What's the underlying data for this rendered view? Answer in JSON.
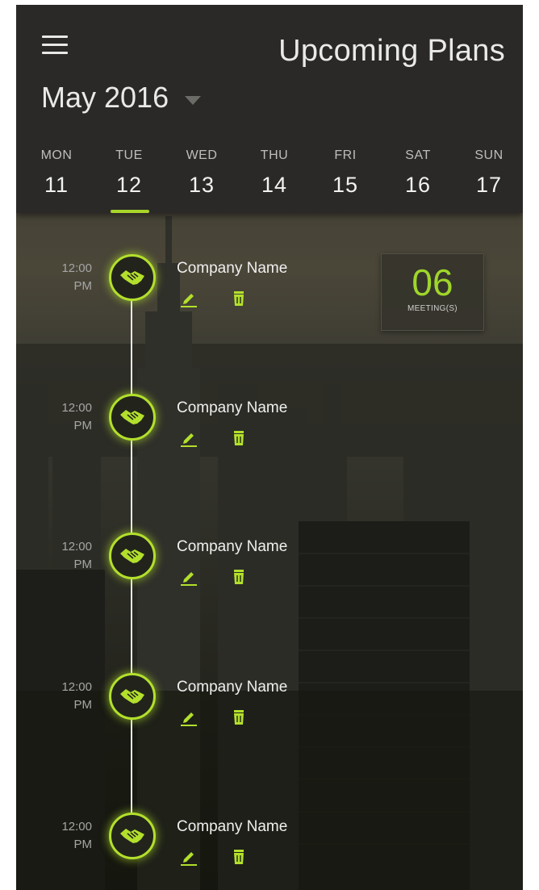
{
  "header": {
    "title": "Upcoming Plans",
    "month": "May 2016"
  },
  "week": [
    {
      "name": "MON",
      "num": "11",
      "active": false
    },
    {
      "name": "TUE",
      "num": "12",
      "active": true
    },
    {
      "name": "WED",
      "num": "13",
      "active": false
    },
    {
      "name": "THU",
      "num": "14",
      "active": false
    },
    {
      "name": "FRI",
      "num": "15",
      "active": false
    },
    {
      "name": "SAT",
      "num": "16",
      "active": false
    },
    {
      "name": "SUN",
      "num": "17",
      "active": false
    }
  ],
  "meetings": {
    "count": "06",
    "label": "MEETING(S)"
  },
  "entries": [
    {
      "time_top": "12:00",
      "time_bottom": "PM",
      "company": "Company Name",
      "icon": "handshake-icon"
    },
    {
      "time_top": "12:00",
      "time_bottom": "PM",
      "company": "Company Name",
      "icon": "handshake-icon"
    },
    {
      "time_top": "12:00",
      "time_bottom": "PM",
      "company": "Company Name",
      "icon": "handshake-icon"
    },
    {
      "time_top": "12:00",
      "time_bottom": "PM",
      "company": "Company Name",
      "icon": "handshake-icon"
    },
    {
      "time_top": "12:00",
      "time_bottom": "PM",
      "company": "Company Name",
      "icon": "handshake-icon"
    }
  ],
  "colors": {
    "accent": "#a8d52a",
    "header_bg": "#2a2927",
    "text": "#efefef"
  }
}
